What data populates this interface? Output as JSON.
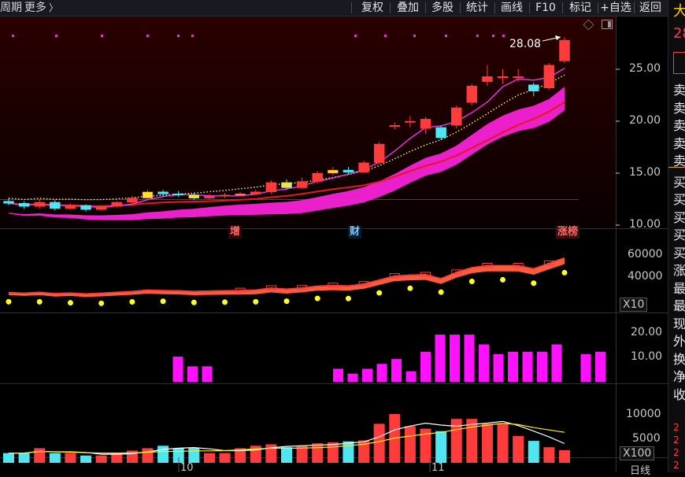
{
  "toolbar": {
    "period_label": "周期",
    "more_label": "更多",
    "more_chevron": "chevron-right-icon",
    "buttons": [
      "复权",
      "叠加",
      "多股",
      "统计",
      "画线",
      "F10",
      "标记",
      "+自选",
      "返回"
    ]
  },
  "main_chart": {
    "price_axis": [
      "25.00",
      "20.00",
      "15.00",
      "10.00"
    ],
    "high_marker": "28.08",
    "events": [
      {
        "label": "增",
        "color": "#ff5a5a"
      },
      {
        "label": "财",
        "color": "#6ab7ff"
      },
      {
        "label": "涨榜",
        "color": "#ff5a5a"
      }
    ],
    "icons": [
      "diamond-icon",
      "panel-toggle-icon"
    ],
    "colors": {
      "up": "#ff3b3b",
      "down": "#4fe6f2",
      "ma5": "#ff33ff",
      "ma_yellow": "#ffff66",
      "ma_red": "#e21a1a",
      "band": "#ff22dd"
    }
  },
  "sub_chart_1": {
    "axis": [
      "60000",
      "40000"
    ],
    "scale_label": "X10"
  },
  "sub_chart_2": {
    "axis": [
      "20.00",
      "10.00"
    ],
    "bar_values": [
      10,
      6,
      6,
      0,
      0,
      0,
      0,
      0,
      0,
      0,
      0,
      5,
      3,
      5,
      7,
      9,
      4,
      12,
      19,
      19,
      19,
      15,
      11,
      12,
      12,
      12,
      15,
      0,
      11,
      12
    ]
  },
  "sub_chart_3": {
    "axis": [
      "10000",
      "5000"
    ],
    "scale_label": "X100"
  },
  "date_axis": {
    "months": [
      "10",
      "11"
    ],
    "period_tab": "日线"
  },
  "right_panel": {
    "title_char": "大",
    "price_fragment": "28",
    "labels": [
      "卖",
      "卖",
      "卖",
      "卖",
      "卖",
      "买",
      "买",
      "买",
      "买",
      "买",
      "涨",
      "最",
      "最",
      "现",
      "外",
      "换",
      "净",
      "收"
    ],
    "mini_values": [
      "2",
      "2",
      "2",
      "2"
    ]
  },
  "candles": [
    {
      "o": 12.3,
      "c": 12.1,
      "h": 12.6,
      "l": 11.9
    },
    {
      "o": 12.1,
      "c": 11.8,
      "h": 12.3,
      "l": 11.6
    },
    {
      "o": 11.8,
      "c": 12.2,
      "h": 12.5,
      "l": 11.6
    },
    {
      "o": 12.2,
      "c": 11.6,
      "h": 12.4,
      "l": 11.4
    },
    {
      "o": 11.6,
      "c": 11.9,
      "h": 12.1,
      "l": 11.5
    },
    {
      "o": 11.9,
      "c": 11.5,
      "h": 12.0,
      "l": 11.3
    },
    {
      "o": 11.5,
      "c": 11.8,
      "h": 11.9,
      "l": 11.4
    },
    {
      "o": 11.8,
      "c": 12.2,
      "h": 12.3,
      "l": 11.7
    },
    {
      "o": 12.2,
      "c": 12.6,
      "h": 12.8,
      "l": 12.0
    },
    {
      "o": 12.6,
      "c": 13.2,
      "h": 13.4,
      "l": 12.5
    },
    {
      "o": 13.2,
      "c": 13.0,
      "h": 13.4,
      "l": 12.8
    },
    {
      "o": 13.0,
      "c": 12.9,
      "h": 13.3,
      "l": 12.7
    },
    {
      "o": 12.9,
      "c": 12.6,
      "h": 13.1,
      "l": 12.4
    },
    {
      "o": 12.6,
      "c": 12.8,
      "h": 13.0,
      "l": 12.5
    },
    {
      "o": 12.8,
      "c": 12.9,
      "h": 13.1,
      "l": 12.6
    },
    {
      "o": 12.9,
      "c": 13.0,
      "h": 13.2,
      "l": 12.8
    },
    {
      "o": 13.0,
      "c": 13.2,
      "h": 13.4,
      "l": 12.9
    },
    {
      "o": 13.2,
      "c": 14.1,
      "h": 14.3,
      "l": 13.0
    },
    {
      "o": 14.1,
      "c": 13.6,
      "h": 14.4,
      "l": 13.4
    },
    {
      "o": 13.6,
      "c": 14.2,
      "h": 14.6,
      "l": 13.5
    },
    {
      "o": 14.2,
      "c": 15.0,
      "h": 15.2,
      "l": 14.0
    },
    {
      "o": 15.0,
      "c": 15.3,
      "h": 15.6,
      "l": 14.8
    },
    {
      "o": 15.3,
      "c": 15.1,
      "h": 15.6,
      "l": 14.9
    },
    {
      "o": 15.1,
      "c": 16.0,
      "h": 16.2,
      "l": 15.0
    },
    {
      "o": 16.0,
      "c": 17.8,
      "h": 18.0,
      "l": 15.8
    },
    {
      "o": 19.6,
      "c": 19.6,
      "h": 19.9,
      "l": 19.2
    },
    {
      "o": 20.0,
      "c": 20.0,
      "h": 20.5,
      "l": 19.4
    },
    {
      "o": 19.3,
      "c": 20.2,
      "h": 20.4,
      "l": 18.8
    },
    {
      "o": 19.4,
      "c": 18.4,
      "h": 19.6,
      "l": 18.2
    },
    {
      "o": 19.6,
      "c": 21.3,
      "h": 21.5,
      "l": 19.3
    },
    {
      "o": 21.8,
      "c": 23.4,
      "h": 23.6,
      "l": 21.5
    },
    {
      "o": 23.8,
      "c": 24.3,
      "h": 25.4,
      "l": 23.4
    },
    {
      "o": 24.3,
      "c": 24.3,
      "h": 25.0,
      "l": 23.6
    },
    {
      "o": 24.3,
      "c": 24.3,
      "h": 25.0,
      "l": 23.8
    },
    {
      "o": 23.5,
      "c": 22.9,
      "h": 23.7,
      "l": 22.4
    },
    {
      "o": 23.2,
      "c": 25.4,
      "h": 25.6,
      "l": 23.0
    },
    {
      "o": 25.8,
      "c": 27.8,
      "h": 28.08,
      "l": 25.6
    }
  ],
  "volumes": [
    2,
    2,
    3,
    2,
    2,
    1.5,
    1.5,
    2,
    2.5,
    3,
    3.5,
    3,
    3,
    2,
    2,
    3,
    3.5,
    3.8,
    3.2,
    3.5,
    4,
    4.2,
    4.4,
    4.6,
    8,
    10,
    7.5,
    7,
    6.5,
    9,
    9,
    8,
    8,
    5.5,
    4.5,
    3.2,
    2.6
  ]
}
